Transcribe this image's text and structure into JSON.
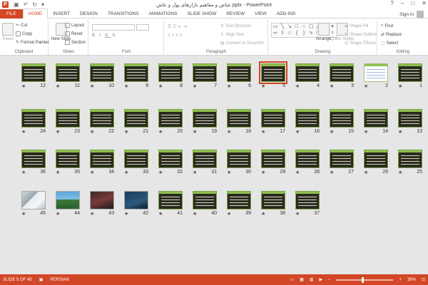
{
  "window": {
    "title": "عیاض و مفاهیم بازارهای پول و عاش.pptx - PowerPoint",
    "controls": [
      "?",
      "–",
      "□",
      "✕"
    ]
  },
  "tabs": {
    "file": "FILE",
    "items": [
      "HOME",
      "INSERT",
      "DESIGN",
      "TRANSITIONS",
      "ANIMATIONS",
      "SLIDE SHOW",
      "REVIEW",
      "VIEW",
      "ADD-INS"
    ],
    "active": "HOME",
    "signin": "Sign in"
  },
  "ribbon": {
    "clipboard": {
      "label": "Clipboard",
      "paste": "Paste",
      "cut": "Cut",
      "copy": "Copy",
      "format_painter": "Format Painter"
    },
    "slides": {
      "label": "Slides",
      "new_slide": "New Slide",
      "layout": "Layout",
      "reset": "Reset",
      "section": "Section"
    },
    "font": {
      "label": "Font"
    },
    "paragraph": {
      "label": "Paragraph",
      "text_direction": "Text Direction",
      "align_text": "Align Text",
      "convert_smartart": "Convert to SmartArt"
    },
    "drawing": {
      "label": "Drawing",
      "arrange": "Arrange",
      "quick_styles": "Quick Styles",
      "shape_fill": "Shape Fill",
      "shape_outline": "Shape Outline",
      "shape_effects": "Shape Effects"
    },
    "editing": {
      "label": "Editing",
      "find": "Find",
      "replace": "Replace",
      "select": "Select"
    }
  },
  "slides": [
    {
      "n": "12"
    },
    {
      "n": "11"
    },
    {
      "n": "10"
    },
    {
      "n": "9"
    },
    {
      "n": "8"
    },
    {
      "n": "7"
    },
    {
      "n": "6"
    },
    {
      "n": "5"
    },
    {
      "n": "4"
    },
    {
      "n": "3"
    },
    {
      "n": "2"
    },
    {
      "n": "1"
    },
    {
      "n": "24"
    },
    {
      "n": "23"
    },
    {
      "n": "22"
    },
    {
      "n": "21"
    },
    {
      "n": "20"
    },
    {
      "n": "19"
    },
    {
      "n": "18"
    },
    {
      "n": "17"
    },
    {
      "n": "16"
    },
    {
      "n": "15"
    },
    {
      "n": "14"
    },
    {
      "n": "13"
    },
    {
      "n": "36"
    },
    {
      "n": "35"
    },
    {
      "n": "34"
    },
    {
      "n": "33"
    },
    {
      "n": "32"
    },
    {
      "n": "31"
    },
    {
      "n": "30"
    },
    {
      "n": "29"
    },
    {
      "n": "28"
    },
    {
      "n": "27"
    },
    {
      "n": "26"
    },
    {
      "n": "25"
    },
    {
      "n": "45"
    },
    {
      "n": "44"
    },
    {
      "n": "43"
    },
    {
      "n": "42"
    },
    {
      "n": "41"
    },
    {
      "n": "40"
    },
    {
      "n": "39"
    },
    {
      "n": "38"
    },
    {
      "n": "37"
    }
  ],
  "selected_slide": "5",
  "status": {
    "slide_of": "SLIDE 5 OF 45",
    "language": "PERSIAN",
    "zoom": "38%"
  },
  "colors": {
    "accent": "#d24726",
    "slide_border": "#7ca34a"
  }
}
